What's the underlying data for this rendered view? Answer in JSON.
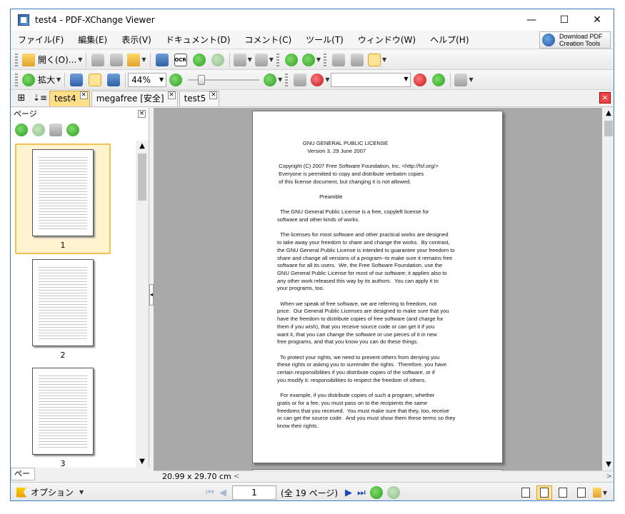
{
  "window": {
    "title": "test4 - PDF-XChange Viewer",
    "minimize": "—",
    "maximize": "☐",
    "close": "✕"
  },
  "menu": [
    "ファイル(F)",
    "編集(E)",
    "表示(V)",
    "ドキュメント(D)",
    "コメント(C)",
    "ツール(T)",
    "ウィンドウ(W)",
    "ヘルプ(H)"
  ],
  "promo": {
    "line1": "Download PDF",
    "line2": "Creation Tools"
  },
  "toolbar1": {
    "open_label": "開く(O)..."
  },
  "toolbar2": {
    "zoom_in_label": "拡大",
    "zoom_value": "44%"
  },
  "tabs": [
    {
      "label": "test4",
      "active": true
    },
    {
      "label": "megafree [安全]",
      "active": false
    },
    {
      "label": "test5",
      "active": false
    }
  ],
  "left_panel": {
    "header": "ページ",
    "bottom_tab": "ページ",
    "thumbnails": [
      {
        "number": "1",
        "selected": true
      },
      {
        "number": "2",
        "selected": false
      },
      {
        "number": "3",
        "selected": false
      }
    ]
  },
  "document": {
    "page_size": "20.99 x 29.70 cm",
    "text": "                 GNU GENERAL PUBLIC LICENSE\n                    Version 3, 29 June 2007\n\n Copyright (C) 2007 Free Software Foundation, Inc. <http://fsf.org/>\n Everyone is permitted to copy and distribute verbatim copies\n of this license document, but changing it is not allowed.\n\n                            Preamble\n\n  The GNU General Public License is a free, copyleft license for\nsoftware and other kinds of works.\n\n  The licenses for most software and other practical works are designed\nto take away your freedom to share and change the works.  By contrast,\nthe GNU General Public License is intended to guarantee your freedom to\nshare and change all versions of a program--to make sure it remains free\nsoftware for all its users.  We, the Free Software Foundation, use the\nGNU General Public License for most of our software; it applies also to\nany other work released this way by its authors.  You can apply it to\nyour programs, too.\n\n  When we speak of free software, we are referring to freedom, not\nprice.  Our General Public Licenses are designed to make sure that you\nhave the freedom to distribute copies of free software (and charge for\nthem if you wish), that you receive source code or can get it if you\nwant it, that you can change the software or use pieces of it in new\nfree programs, and that you know you can do these things.\n\n  To protect your rights, we need to prevent others from denying you\nthese rights or asking you to surrender the rights.  Therefore, you have\ncertain responsibilities if you distribute copies of the software, or if\nyou modify it: responsibilities to respect the freedom of others.\n\n  For example, if you distribute copies of such a program, whether\ngratis or for a fee, you must pass on to the recipients the same\nfreedoms that you received.  You must make sure that they, too, receive\nor can get the source code.  And you must show them these terms so they\nknow their rights."
  },
  "status": {
    "options_label": "オプション",
    "current_page": "1",
    "total_pages": "(全 19 ページ)"
  },
  "colors": {
    "accent": "#ffe08a",
    "window_border": "#3c7fc0",
    "doc_bg": "#a9a9a9"
  }
}
